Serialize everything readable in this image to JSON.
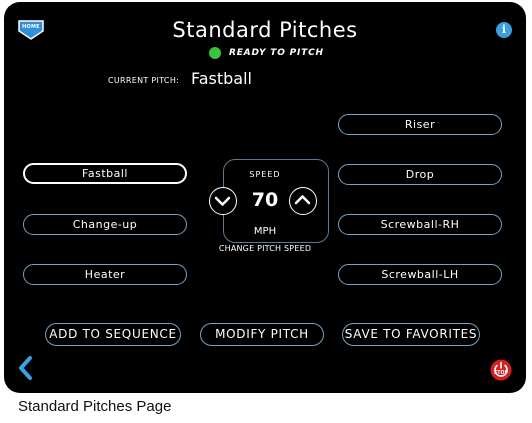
{
  "header": {
    "home_label": "HOME",
    "title": "Standard Pitches",
    "info_label": "i"
  },
  "status": {
    "text": "READY TO PITCH",
    "color": "#3ac43a"
  },
  "current_pitch": {
    "label": "CURRENT PITCH:",
    "value": "Fastball"
  },
  "pitches_left": [
    "Fastball",
    "Change-up",
    "Heater"
  ],
  "pitches_right": [
    "Riser",
    "Drop",
    "Screwball-RH",
    "Screwball-LH"
  ],
  "selected_pitch": "Fastball",
  "speed": {
    "label": "SPEED",
    "value": "70",
    "unit": "MPH",
    "caption": "CHANGE PITCH SPEED"
  },
  "actions": {
    "add": "ADD TO SEQUENCE",
    "modify": "MODIFY PITCH",
    "save": "SAVE TO FAVORITES"
  },
  "footer": {
    "stop_label": "STOP"
  },
  "caption": "Standard Pitches Page",
  "colors": {
    "accent_border": "#6fa3c7",
    "info_blue": "#3b9fe0",
    "home_blue": "#2f8fd8",
    "stop_red": "#d42020"
  }
}
